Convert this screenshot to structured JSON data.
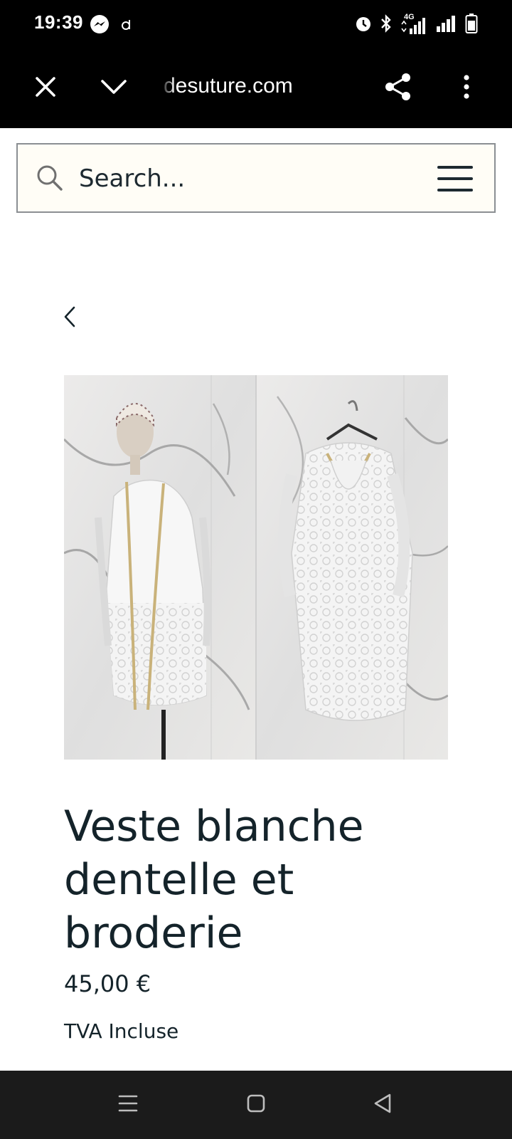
{
  "status_bar": {
    "time": "19:39",
    "left_icons": [
      "messenger-icon",
      "app-notification-icon"
    ],
    "right_icons": [
      "alarm-icon",
      "bluetooth-icon",
      "signal-4g-icon",
      "signal-icon",
      "battery-icon"
    ],
    "network_label": "4G"
  },
  "browser": {
    "url": "desuture.com",
    "icons": [
      "close-icon",
      "chevron-down-icon",
      "share-icon",
      "more-vert-icon"
    ]
  },
  "search": {
    "placeholder": "Search...",
    "icon": "search-icon",
    "menu_icon": "hamburger-menu-icon"
  },
  "product": {
    "title": "Veste blanche dentelle et broderie",
    "price": "45,00 €",
    "tax_note": "TVA Incluse"
  },
  "navigation": {
    "icons": [
      "recent-apps-icon",
      "home-icon",
      "back-icon"
    ]
  },
  "colors": {
    "text_dark": "#14232a",
    "search_bg": "#fffdf6",
    "bar_bg": "#000000",
    "nav_bg": "#1b1b1b"
  }
}
